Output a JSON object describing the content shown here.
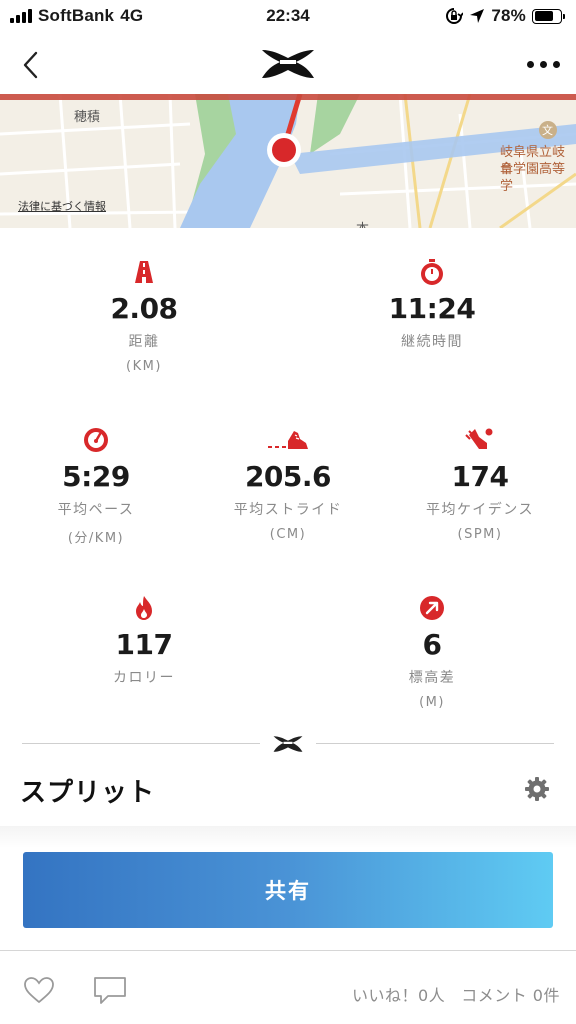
{
  "status_bar": {
    "carrier": "SoftBank",
    "network": "4G",
    "time": "22:34",
    "battery": "78%",
    "battery_level": 0.78
  },
  "map": {
    "labels": {
      "place_1": "穂積",
      "school_line_1": "岐阜県立岐阜",
      "school_line_2": "合学園高等学",
      "partial": "本",
      "legal": "法律に基づく情報",
      "school_badge": "文"
    },
    "colors": {
      "route": "#e03a2f",
      "river": "#a9c8ef",
      "park": "#a7d4a0"
    }
  },
  "stats": {
    "distance": {
      "value": "2.08",
      "label": "距離",
      "unit": "(KM)",
      "icon": "road-icon"
    },
    "duration": {
      "value": "11:24",
      "label": "継続時間",
      "icon": "stopwatch-icon"
    },
    "pace": {
      "value": "5:29",
      "label": "平均ペース",
      "unit": "(分/KM)",
      "icon": "speedometer-icon"
    },
    "stride": {
      "value": "205.6",
      "label": "平均ストライド",
      "unit": "(CM)",
      "icon": "shoe-stride-icon"
    },
    "cadence": {
      "value": "174",
      "label": "平均ケイデンス",
      "unit": "(SPM)",
      "icon": "shoe-cadence-icon"
    },
    "calories": {
      "value": "117",
      "label": "カロリー",
      "icon": "flame-icon"
    },
    "elevation": {
      "value": "6",
      "label": "標高差",
      "unit": "(M)",
      "icon": "elevation-arrow-icon"
    }
  },
  "split": {
    "title": "スプリット"
  },
  "share": {
    "label": "共有"
  },
  "footer": {
    "likes": "いいね！0人",
    "comments": "コメント 0件"
  },
  "colors": {
    "accent": "#d8282a",
    "share_start": "#3474c2",
    "share_end": "#5fcbf3"
  }
}
